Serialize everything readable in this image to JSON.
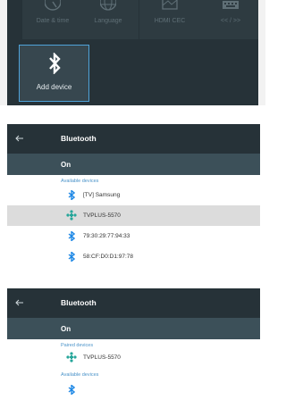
{
  "tiles": [
    {
      "label": "Date & time",
      "icon": "clock-icon"
    },
    {
      "label": "Language",
      "icon": "globe-icon"
    },
    {
      "label": "HDMI CEC",
      "icon": "hdmi-icon"
    },
    {
      "label": "<< / >>",
      "icon": "keyboard-icon"
    }
  ],
  "add_device": {
    "label": "Add device",
    "icon": "bluetooth-icon"
  },
  "screen2": {
    "title": "Bluetooth",
    "status": "On",
    "available_label": "Available devices",
    "devices": [
      {
        "name": "[TV] Samsung",
        "icon": "bluetooth-icon",
        "highlighted": false
      },
      {
        "name": "TVPLUS-5570",
        "icon": "bluetooth-connected-icon",
        "highlighted": true
      },
      {
        "name": "79:30:29:77:94:33",
        "icon": "bluetooth-icon",
        "highlighted": false
      },
      {
        "name": "58:CF:D0:D1:97:78",
        "icon": "bluetooth-icon",
        "highlighted": false
      }
    ]
  },
  "screen3": {
    "title": "Bluetooth",
    "status": "On",
    "paired_label": "Paired devices",
    "paired": [
      {
        "name": "TVPLUS-5570",
        "icon": "bluetooth-connected-icon"
      }
    ],
    "available_label": "Available devices"
  },
  "colors": {
    "header": "#263238",
    "on_row": "#3c5059",
    "accent": "#4a93c9",
    "bt_icon": "#1e88e5",
    "connected_icon": "#26a69a"
  }
}
